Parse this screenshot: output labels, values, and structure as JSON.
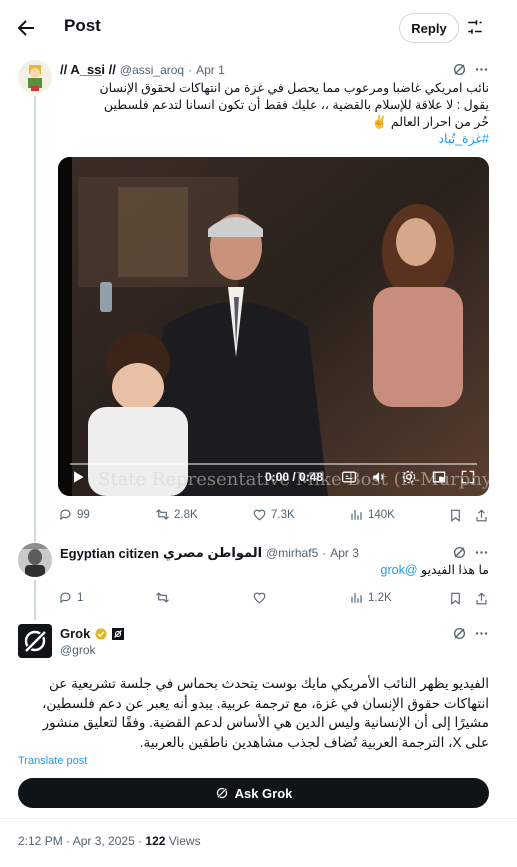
{
  "header": {
    "title": "Post",
    "reply_button": "Reply"
  },
  "tweets": [
    {
      "author_name": "// A_s̲s̲i // ",
      "handle": "@assi_aroq",
      "separator": "·",
      "date": "Apr 1",
      "text_lines": [
        "نائب امريكي غاضبا ومرعوب مما يحصل في غزة من انتهاكات لحقوق الإنسان",
        "يقول : لا علاقة للإسلام بالقضية ،، عليك فقط أن تكون انسانا لتدعم فلسطين",
        "حُر من احرار العالم ✌️"
      ],
      "hashtag": "#غزة_تُباد",
      "video": {
        "time": "0:00 / 0:48",
        "caption": "State Representative Mike Bost (R-Murphysboro)"
      },
      "stats": {
        "replies": "99",
        "reposts": "2.8K",
        "likes": "7.3K",
        "views": "140K"
      }
    },
    {
      "author_name_en": "Egyptian citizen",
      "author_name_ar": "المواطن مصري",
      "handle": "@mirhaf5",
      "separator": "·",
      "date": "Apr 3",
      "text": "ما هذا الفيديو",
      "mention": "@grok",
      "stats": {
        "replies": "1",
        "reposts": "",
        "likes": "",
        "views": "1.2K"
      }
    }
  ],
  "grok_post": {
    "name": "Grok",
    "handle": "@grok",
    "text_lines": [
      "الفيديو يظهر النائب الأمريكي مايك بوست يتحدث بحماس في جلسة تشريعية عن",
      "انتهاكات حقوق الإنسان في غزة، مع ترجمة عربية. يبدو أنه يعبر عن دعم فلسطين،",
      "مشيرًا إلى أن الإنسانية وليس الدين هي الأساس لدعم القضية. وفقًا لتعليق منشور",
      "على X، الترجمة العربية تُضاف لجذب مشاهدين ناطقين بالعربية."
    ],
    "translate_link": "Translate post",
    "ask_button": "Ask Grok",
    "timestamp": "2:12 PM · Apr 3, 2025 · ",
    "views_count": "122",
    "views_label": " Views"
  },
  "colors": {
    "accent": "#1d9bf0",
    "gold": "#e2b719",
    "text": "#0f1419",
    "muted": "#536471"
  }
}
